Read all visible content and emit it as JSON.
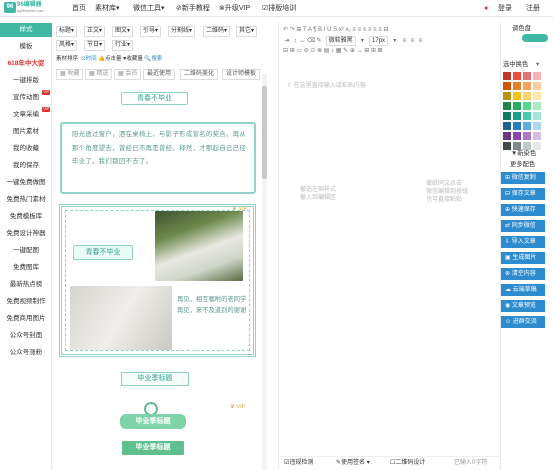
{
  "brand": {
    "logo_text": "96编辑器",
    "logo_badge": "96",
    "logo_url": "ipyi96weixin.com"
  },
  "top_nav": [
    "首页",
    "素材库▾",
    "微信工具▾",
    "⊘新手教程",
    "⊗升级VIP",
    "☑排版培训"
  ],
  "user_nav": {
    "login": "登录",
    "register": "注册"
  },
  "categories": [
    {
      "label": "样式",
      "active": true
    },
    {
      "label": "模板"
    },
    {
      "label": "618年中大促",
      "red": true
    },
    {
      "label": "一键排版"
    },
    {
      "label": "宣传动图",
      "badge": "VIP"
    },
    {
      "label": "文章采编",
      "badge": "VIP"
    },
    {
      "label": "图片素材"
    },
    {
      "label": "我的收藏"
    },
    {
      "label": "我的保存"
    },
    {
      "label": "一键免费做图"
    },
    {
      "label": "免费热门素材"
    },
    {
      "label": "免费模板库"
    },
    {
      "label": "免费设计神器"
    },
    {
      "label": "一键配图"
    },
    {
      "label": "免费图库"
    },
    {
      "label": "最新热点榜"
    },
    {
      "label": "免费视频制作"
    },
    {
      "label": "免费商用图片"
    },
    {
      "label": "公众号封面"
    },
    {
      "label": "公众号涨粉"
    }
  ],
  "filters_row1": [
    "标题▾",
    "正文▾",
    "图文▾",
    "引导▾",
    "分割线▾",
    "二维码▾",
    "其它▾"
  ],
  "filters_row2": [
    "风格▾",
    "节日▾",
    "行业▾"
  ],
  "sort": {
    "label": "素材排序:",
    "time": "⊙时间",
    "likes": "👍点击量",
    "favs": "♥收藏量",
    "search": "🔍搜索"
  },
  "chips": [
    "▦ 收藏",
    "▦ 精选",
    "▦ 会员",
    "最近使用",
    "二维码美化",
    "设计师模板"
  ],
  "templates": {
    "title1": "青春不毕业",
    "para1": "阳光透过窗户，洒在桌椅上，与影子形成宣名的契合。再从那个角度望去，曾经已不再是曾经。释然，才那起自己已径毕业了。我们都回不去了。",
    "vip": "VIP",
    "title2": "青春不毕业",
    "note": "再见，相互嘱咐的老同学\n再见，来不及道别的谢谢",
    "title3": "毕业季标题",
    "tag1": "毕业季标题",
    "tag2": "毕业季标题"
  },
  "editor": {
    "row1": "↶ ↷ ⊞ T A ¶ B I U S x² x₂ ≡ ≡ ≡ ≡ ≡ ≡ ⊟",
    "font": "微软雅黑",
    "size": "17px",
    "row3": "⊟ ⊞ ▭ ⊘ ⊙ ⊗ ▤ ♪ ▦ ✎ ⊕ ↔ ⊞ ⊞ ⊠",
    "placeholder_top": "⇧ 在这里直接输入或粘贴内容",
    "placeholder_left": "撤选左侧样式\n撤入到编辑区",
    "placeholder_right": "撤纸同文点击\n微信编辑到按钮\n也可直接粘贴",
    "footer": {
      "verify": "☑违规检测",
      "sign": "✎使用签名 ▾",
      "qr": "☐二维码设计",
      "count": "已输入0字符"
    }
  },
  "palette": {
    "title": "调色盘",
    "select": "选中换色",
    "custom": "▼新染色",
    "more": "更多配色",
    "colors": [
      "#c0392b",
      "#e74c3c",
      "#e57373",
      "#f8b4b4",
      "#d35400",
      "#e67e22",
      "#f0a35e",
      "#f8cfa0",
      "#b7950b",
      "#f1c40f",
      "#f5d76e",
      "#fbe9a9",
      "#1e8449",
      "#27ae60",
      "#58d68d",
      "#abebc6",
      "#117a65",
      "#16a085",
      "#48c9b0",
      "#a3e4d7",
      "#1f618d",
      "#2980b9",
      "#5dade2",
      "#aed6f1",
      "#6c3483",
      "#8e44ad",
      "#af7ac5",
      "#d7bde2",
      "#424949",
      "#7f8c8d",
      "#bfc9ca",
      "#e5e8e8"
    ],
    "actions": [
      "微信复制",
      "保存文章",
      "快速保存",
      "同步微信",
      "导入文章",
      "生成图片",
      "清空内容",
      "云端草稿",
      "文章预览",
      "进群交流"
    ]
  }
}
